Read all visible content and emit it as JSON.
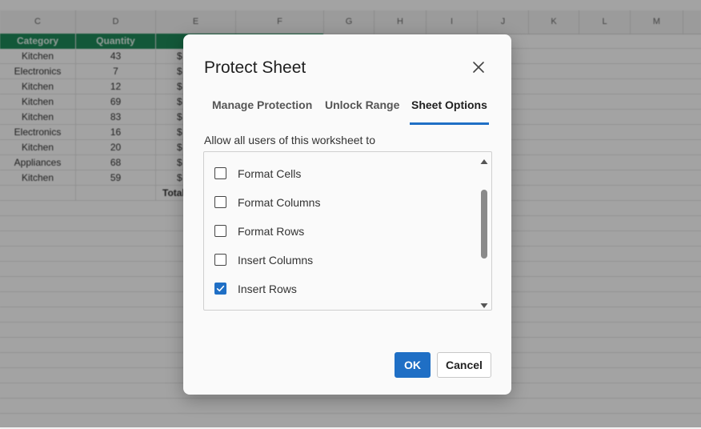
{
  "sheet": {
    "columns": [
      "C",
      "D",
      "E",
      "F",
      "G",
      "H",
      "I",
      "J",
      "K",
      "L",
      "M"
    ],
    "header_row": [
      "Category",
      "Quantity",
      ""
    ],
    "rows": [
      [
        "Kitchen",
        "43",
        "$"
      ],
      [
        "Electronics",
        "7",
        "$"
      ],
      [
        "Kitchen",
        "12",
        "$"
      ],
      [
        "Kitchen",
        "69",
        "$"
      ],
      [
        "Kitchen",
        "83",
        "$"
      ],
      [
        "Electronics",
        "16",
        "$"
      ],
      [
        "Kitchen",
        "20",
        "$"
      ],
      [
        "Appliances",
        "68",
        "$"
      ],
      [
        "Kitchen",
        "59",
        "$"
      ]
    ],
    "total_label": "Total"
  },
  "dialog": {
    "title": "Protect Sheet",
    "tabs": [
      {
        "label": "Manage Protection",
        "active": false
      },
      {
        "label": "Unlock Range",
        "active": false
      },
      {
        "label": "Sheet Options",
        "active": true
      }
    ],
    "instruction": "Allow all users of this worksheet to",
    "options": [
      {
        "label": "Format Cells",
        "checked": false
      },
      {
        "label": "Format Columns",
        "checked": false
      },
      {
        "label": "Format Rows",
        "checked": false
      },
      {
        "label": "Insert Columns",
        "checked": false
      },
      {
        "label": "Insert Rows",
        "checked": true
      }
    ],
    "ok_label": "OK",
    "cancel_label": "Cancel",
    "icons": {
      "close": "close-icon",
      "check": "checkmark-icon",
      "scroll_up": "caret-up-icon",
      "scroll_down": "caret-down-icon"
    }
  },
  "colors": {
    "accent": "#1f6fc5",
    "header_green": "#1e8a5a",
    "overlay": "rgba(0,0,0,0.36)"
  }
}
